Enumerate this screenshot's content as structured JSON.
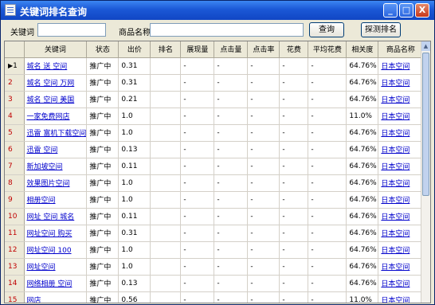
{
  "window": {
    "title": "关键词排名查询"
  },
  "titlebar_buttons": {
    "minimize": "_",
    "maximize": "□",
    "close": "X"
  },
  "search": {
    "keyword_label": "关键词",
    "keyword_value": "",
    "product_label": "商品名称",
    "product_value": "",
    "query_button": "查询",
    "detect_button": "探测排名"
  },
  "table": {
    "columns": [
      "",
      "关键词",
      "状态",
      "出价",
      "排名",
      "展现量",
      "点击量",
      "点击率",
      "花费",
      "平均花费",
      "相关度",
      "商品名称"
    ],
    "rows": [
      {
        "n": "1",
        "kw": "城名 送 空间",
        "status": "推广中",
        "bid": "0.31",
        "rank": "",
        "imp": "-",
        "clk": "-",
        "ctr": "-",
        "cost": "-",
        "avg": "-",
        "rel": "64.76%",
        "name": "日本空间"
      },
      {
        "n": "2",
        "kw": "城名 空间 万网",
        "status": "推广中",
        "bid": "0.31",
        "rank": "",
        "imp": "-",
        "clk": "-",
        "ctr": "-",
        "cost": "-",
        "avg": "-",
        "rel": "64.76%",
        "name": "日本空间"
      },
      {
        "n": "3",
        "kw": "城名 空间 美国",
        "status": "推广中",
        "bid": "0.21",
        "rank": "",
        "imp": "-",
        "clk": "-",
        "ctr": "-",
        "cost": "-",
        "avg": "-",
        "rel": "64.76%",
        "name": "日本空间"
      },
      {
        "n": "4",
        "kw": "一家免费网店",
        "status": "推广中",
        "bid": "1.0",
        "rank": "",
        "imp": "-",
        "clk": "-",
        "ctr": "-",
        "cost": "-",
        "avg": "-",
        "rel": "11.0%",
        "name": "日本空间"
      },
      {
        "n": "5",
        "kw": "迅雷 富机下载空间",
        "status": "推广中",
        "bid": "1.0",
        "rank": "",
        "imp": "-",
        "clk": "-",
        "ctr": "-",
        "cost": "-",
        "avg": "-",
        "rel": "64.76%",
        "name": "日本空间"
      },
      {
        "n": "6",
        "kw": "迅雷 空间",
        "status": "推广中",
        "bid": "0.13",
        "rank": "",
        "imp": "-",
        "clk": "-",
        "ctr": "-",
        "cost": "-",
        "avg": "-",
        "rel": "64.76%",
        "name": "日本空间"
      },
      {
        "n": "7",
        "kw": "新加坡空间",
        "status": "推广中",
        "bid": "0.11",
        "rank": "",
        "imp": "-",
        "clk": "-",
        "ctr": "-",
        "cost": "-",
        "avg": "-",
        "rel": "64.76%",
        "name": "日本空间"
      },
      {
        "n": "8",
        "kw": "效果图片空间",
        "status": "推广中",
        "bid": "1.0",
        "rank": "",
        "imp": "-",
        "clk": "-",
        "ctr": "-",
        "cost": "-",
        "avg": "-",
        "rel": "64.76%",
        "name": "日本空间"
      },
      {
        "n": "9",
        "kw": "相册空间",
        "status": "推广中",
        "bid": "1.0",
        "rank": "",
        "imp": "-",
        "clk": "-",
        "ctr": "-",
        "cost": "-",
        "avg": "-",
        "rel": "64.76%",
        "name": "日本空间"
      },
      {
        "n": "10",
        "kw": "网址 空间 城名",
        "status": "推广中",
        "bid": "0.11",
        "rank": "",
        "imp": "-",
        "clk": "-",
        "ctr": "-",
        "cost": "-",
        "avg": "-",
        "rel": "64.76%",
        "name": "日本空间"
      },
      {
        "n": "11",
        "kw": "网址空间 购买",
        "status": "推广中",
        "bid": "0.31",
        "rank": "",
        "imp": "-",
        "clk": "-",
        "ctr": "-",
        "cost": "-",
        "avg": "-",
        "rel": "64.76%",
        "name": "日本空间"
      },
      {
        "n": "12",
        "kw": "网址空间 100",
        "status": "推广中",
        "bid": "1.0",
        "rank": "",
        "imp": "-",
        "clk": "-",
        "ctr": "-",
        "cost": "-",
        "avg": "-",
        "rel": "64.76%",
        "name": "日本空间"
      },
      {
        "n": "13",
        "kw": "网址空间",
        "status": "推广中",
        "bid": "1.0",
        "rank": "",
        "imp": "-",
        "clk": "-",
        "ctr": "-",
        "cost": "-",
        "avg": "-",
        "rel": "64.76%",
        "name": "日本空间"
      },
      {
        "n": "14",
        "kw": "网络相册 空间",
        "status": "推广中",
        "bid": "0.13",
        "rank": "",
        "imp": "-",
        "clk": "-",
        "ctr": "-",
        "cost": "-",
        "avg": "-",
        "rel": "64.76%",
        "name": "日本空间"
      },
      {
        "n": "15",
        "kw": "网店",
        "status": "推广中",
        "bid": "0.56",
        "rank": "",
        "imp": "-",
        "clk": "-",
        "ctr": "-",
        "cost": "-",
        "avg": "-",
        "rel": "11.0%",
        "name": "日本空间"
      }
    ]
  },
  "colors": {
    "title_bar": "#1b58d6",
    "link": "#0000cc",
    "row_number": "#c00000"
  }
}
